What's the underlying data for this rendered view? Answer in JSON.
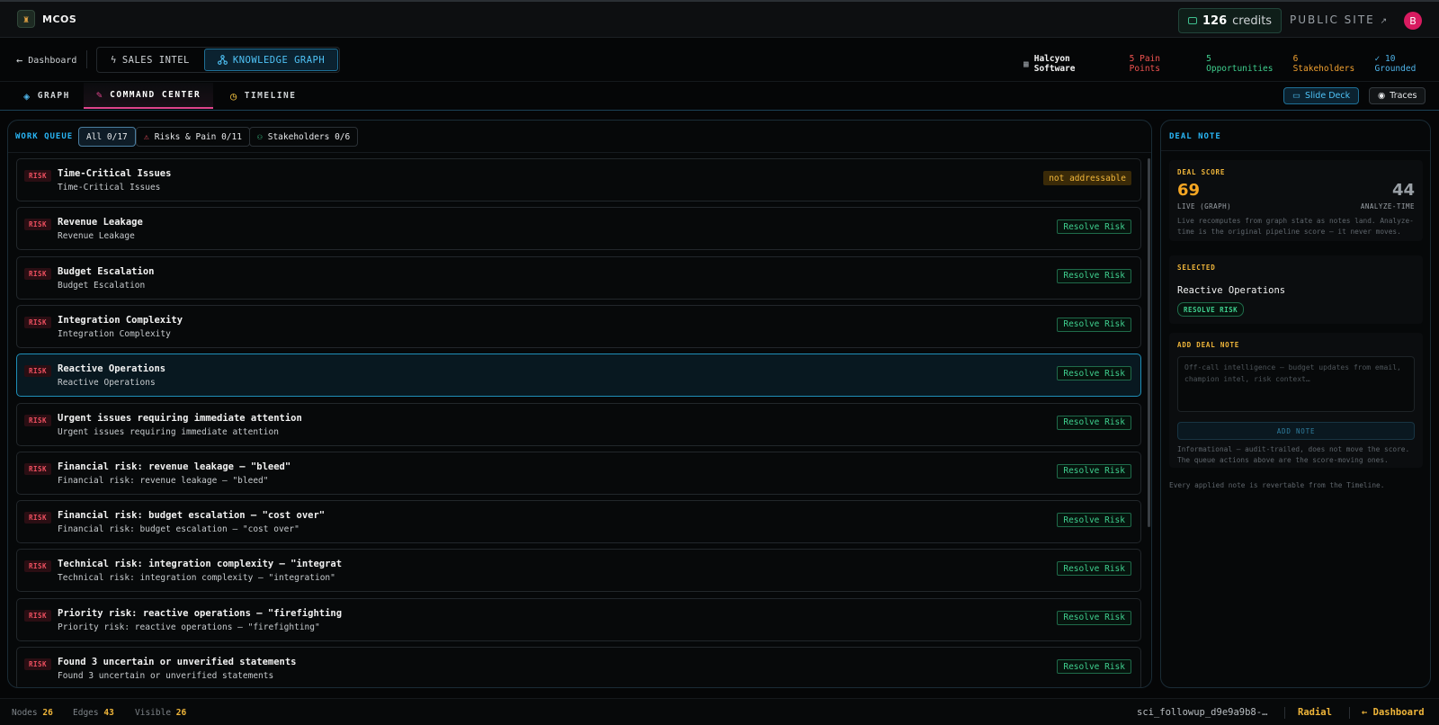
{
  "app": {
    "name": "MCOS",
    "logo_icon": "robot-icon"
  },
  "topbar": {
    "credits_count": "126",
    "credits_label": "credits",
    "public_site": "PUBLIC SITE",
    "avatar_initial": "B"
  },
  "nav": {
    "back_label": "Dashboard",
    "mode_tabs": [
      {
        "label": "SALES INTEL",
        "icon": "bolt-icon",
        "active": false
      },
      {
        "label": "KNOWLEDGE GRAPH",
        "icon": "graph-nodes-icon",
        "active": true
      }
    ],
    "company": "Halcyon Software",
    "stats": {
      "pain": "5 Pain Points",
      "opportunities": "5 Opportunities",
      "stakeholders": "6 Stakeholders",
      "grounded": "✓ 10 Grounded"
    }
  },
  "subtabs": [
    {
      "label": "GRAPH",
      "icon": "layers-icon",
      "active": false
    },
    {
      "label": "COMMAND CENTER",
      "icon": "wrench-icon",
      "active": true
    },
    {
      "label": "TIMELINE",
      "icon": "clock-icon",
      "active": false
    }
  ],
  "actions": {
    "slide_deck": "Slide Deck",
    "traces": "Traces"
  },
  "work_queue": {
    "title": "WORK QUEUE",
    "filters": [
      {
        "label": "All 0/17",
        "active": true
      },
      {
        "label": "Risks & Pain 0/11",
        "active": false
      },
      {
        "label": "Stakeholders 0/6",
        "active": false
      }
    ],
    "tag": "RISK",
    "items": [
      {
        "title": "Time-Critical Issues",
        "subtitle": "Time-Critical Issues",
        "action": "not addressable",
        "action_type": "na",
        "selected": false
      },
      {
        "title": "Revenue Leakage",
        "subtitle": "Revenue Leakage",
        "action": "Resolve Risk",
        "action_type": "resolve",
        "selected": false
      },
      {
        "title": "Budget Escalation",
        "subtitle": "Budget Escalation",
        "action": "Resolve Risk",
        "action_type": "resolve",
        "selected": false
      },
      {
        "title": "Integration Complexity",
        "subtitle": "Integration Complexity",
        "action": "Resolve Risk",
        "action_type": "resolve",
        "selected": false
      },
      {
        "title": "Reactive Operations",
        "subtitle": "Reactive Operations",
        "action": "Resolve Risk",
        "action_type": "resolve",
        "selected": true
      },
      {
        "title": "Urgent issues requiring immediate attention",
        "subtitle": "Urgent issues requiring immediate attention",
        "action": "Resolve Risk",
        "action_type": "resolve",
        "selected": false
      },
      {
        "title": "Financial risk: revenue leakage — \"bleed\"",
        "subtitle": "Financial risk: revenue leakage — \"bleed\"",
        "action": "Resolve Risk",
        "action_type": "resolve",
        "selected": false
      },
      {
        "title": "Financial risk: budget escalation — \"cost over\"",
        "subtitle": "Financial risk: budget escalation — \"cost over\"",
        "action": "Resolve Risk",
        "action_type": "resolve",
        "selected": false
      },
      {
        "title": "Technical risk: integration complexity — \"integrat",
        "subtitle": "Technical risk: integration complexity — \"integration\"",
        "action": "Resolve Risk",
        "action_type": "resolve",
        "selected": false
      },
      {
        "title": "Priority risk: reactive operations — \"firefighting",
        "subtitle": "Priority risk: reactive operations — \"firefighting\"",
        "action": "Resolve Risk",
        "action_type": "resolve",
        "selected": false
      },
      {
        "title": "Found 3 uncertain or unverified statements",
        "subtitle": "Found 3 uncertain or unverified statements",
        "action": "Resolve Risk",
        "action_type": "resolve",
        "selected": false
      }
    ]
  },
  "deal_note": {
    "title": "DEAL NOTE",
    "score_label": "DEAL SCORE",
    "live_score": "69",
    "live_label": "LIVE (GRAPH)",
    "analyze_score": "44",
    "analyze_label": "ANALYZE-TIME",
    "score_note_1": "Live recomputes from graph state as notes land. Analyze-",
    "score_note_2": "time is the original pipeline score — it never moves.",
    "selected_label": "SELECTED",
    "selected_name": "Reactive Operations",
    "selected_action": "RESOLVE RISK",
    "add_label": "ADD DEAL NOTE",
    "placeholder_1": "Off-call intelligence — budget updates from email,",
    "placeholder_2": "champion intel, risk context…",
    "add_button": "ADD NOTE",
    "info_1": "Informational — audit-trailed, does not move the score.",
    "info_2": "The queue actions above are the score-moving ones.",
    "footer_note": "Every applied note is revertable from the Timeline."
  },
  "footer": {
    "nodes_label": "Nodes",
    "nodes": "26",
    "edges_label": "Edges",
    "edges": "43",
    "visible_label": "Visible",
    "visible": "26",
    "session_id": "sci_followup_d9e9a9b8-…",
    "radial": "Radial",
    "dashboard": "← Dashboard"
  },
  "colors": {
    "accent": "#29b6f6",
    "risk": "#ef5060",
    "resolve": "#3fcf8e",
    "warn": "#f0b63a",
    "tab_active": "#e0448c"
  }
}
